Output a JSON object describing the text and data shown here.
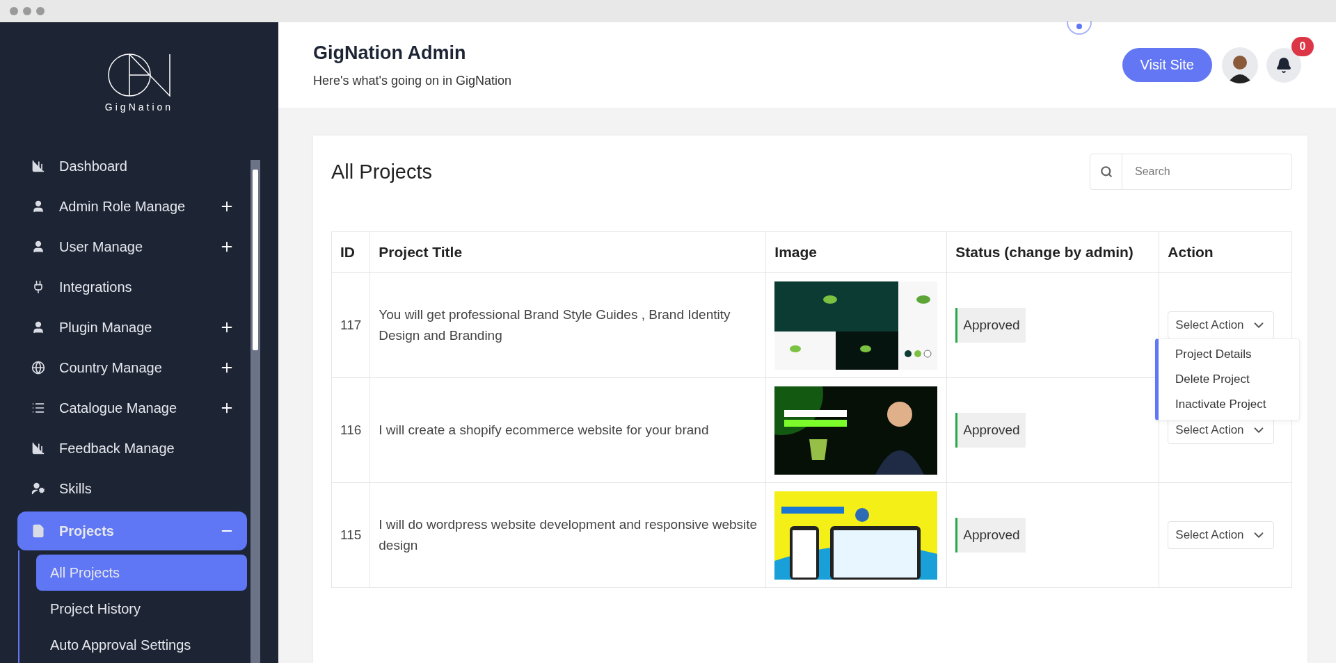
{
  "sidebar": {
    "brand": "GigNation",
    "items": [
      {
        "label": "Dashboard",
        "selected": false
      },
      {
        "label": "Admin Role Manage",
        "selected": false,
        "expanded": false
      },
      {
        "label": "User Manage",
        "selected": false,
        "expanded": false
      },
      {
        "label": "Integrations",
        "selected": false
      },
      {
        "label": "Plugin Manage",
        "selected": false,
        "expanded": false
      },
      {
        "label": "Country Manage",
        "selected": false,
        "expanded": false
      },
      {
        "label": "Catalogue Manage",
        "selected": false,
        "expanded": false
      },
      {
        "label": "Feedback Manage",
        "selected": false
      },
      {
        "label": "Skills",
        "selected": false
      },
      {
        "label": "Projects",
        "selected": true,
        "expanded": true,
        "children": [
          {
            "label": "All Projects",
            "selected": true
          },
          {
            "label": "Project History",
            "selected": false
          },
          {
            "label": "Auto Approval Settings",
            "selected": false
          }
        ]
      }
    ]
  },
  "header": {
    "title": "GigNation Admin",
    "subtitle": "Here's what's going on in GigNation",
    "visit_button": "Visit Site",
    "notification_count": "0"
  },
  "card": {
    "title": "All Projects",
    "search": {
      "placeholder": "Search"
    },
    "table": {
      "columns": [
        "ID",
        "Project Title",
        "Image",
        "Status (change by admin)",
        "Action"
      ],
      "rows": [
        {
          "id": "117",
          "title": "You will get professional Brand Style Guides , Brand Identity Design and Branding",
          "status": "Approved",
          "action": "Select Action",
          "menu": {
            "open": true,
            "items": [
              "Project Details",
              "Delete Project",
              "Inactivate Project"
            ]
          }
        },
        {
          "id": "116",
          "title": "I will create a shopify ecommerce website for your brand",
          "status": "Approved",
          "action": "Select Action"
        },
        {
          "id": "115",
          "title": "I will do wordpress website development and responsive website design",
          "status": "Approved",
          "action": "Select Action"
        }
      ]
    }
  }
}
